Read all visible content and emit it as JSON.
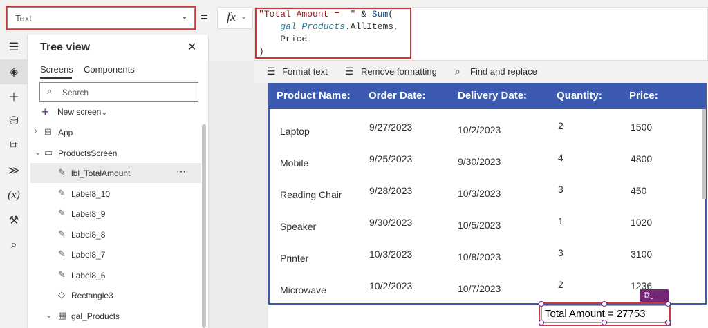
{
  "formula_bar": {
    "property": "Text",
    "equals": "=",
    "fx_label": "fx",
    "formula_lines": [
      {
        "parts": [
          {
            "t": "\"Total Amount =  \"",
            "k": "str"
          },
          {
            "t": " & ",
            "k": "pln"
          },
          {
            "t": "Sum",
            "k": "fn"
          },
          {
            "t": "(",
            "k": "pln"
          }
        ]
      },
      {
        "parts": [
          {
            "t": "    ",
            "k": "pln"
          },
          {
            "t": "gal_Products",
            "k": "ctl"
          },
          {
            "t": ".AllItems,",
            "k": "pln"
          }
        ]
      },
      {
        "parts": [
          {
            "t": "    Price",
            "k": "pln"
          }
        ]
      },
      {
        "parts": [
          {
            "t": ")",
            "k": "pln"
          }
        ]
      }
    ]
  },
  "toolbar": {
    "format_text": "Format text",
    "remove_formatting": "Remove formatting",
    "find_replace": "Find and replace"
  },
  "tree": {
    "title": "Tree view",
    "tabs": {
      "screens": "Screens",
      "components": "Components"
    },
    "search_placeholder": "Search",
    "new_screen": "New screen",
    "items": [
      {
        "label": "App",
        "icon": "app-icon",
        "glyph": "⊞",
        "chevron": "›",
        "indent": 0
      },
      {
        "label": "ProductsScreen",
        "icon": "screen-icon",
        "glyph": "▭",
        "chevron": "⌄",
        "indent": 0
      },
      {
        "label": "lbl_TotalAmount",
        "icon": "label-icon",
        "glyph": "✎",
        "chevron": "",
        "indent": 1,
        "selected": true
      },
      {
        "label": "Label8_10",
        "icon": "label-icon",
        "glyph": "✎",
        "chevron": "",
        "indent": 1
      },
      {
        "label": "Label8_9",
        "icon": "label-icon",
        "glyph": "✎",
        "chevron": "",
        "indent": 1
      },
      {
        "label": "Label8_8",
        "icon": "label-icon",
        "glyph": "✎",
        "chevron": "",
        "indent": 1
      },
      {
        "label": "Label8_7",
        "icon": "label-icon",
        "glyph": "✎",
        "chevron": "",
        "indent": 1
      },
      {
        "label": "Label8_6",
        "icon": "label-icon",
        "glyph": "✎",
        "chevron": "",
        "indent": 1
      },
      {
        "label": "Rectangle3",
        "icon": "rectangle-icon",
        "glyph": "◇",
        "chevron": "",
        "indent": 1
      },
      {
        "label": "gal_Products",
        "icon": "gallery-icon",
        "glyph": "▦",
        "chevron": "⌄",
        "indent": 1
      }
    ]
  },
  "gallery": {
    "headers": [
      "Product Name:",
      "Order Date:",
      "Delivery Date:",
      "Quantity:",
      "Price:"
    ],
    "rows": [
      {
        "name": "Laptop",
        "order": "9/27/2023",
        "delivery": "10/2/2023",
        "qty": "2",
        "price": "1500"
      },
      {
        "name": "Mobile",
        "order": "9/25/2023",
        "delivery": "9/30/2023",
        "qty": "4",
        "price": "4800"
      },
      {
        "name": "Reading Chair",
        "order": "9/28/2023",
        "delivery": "10/3/2023",
        "qty": "3",
        "price": "450"
      },
      {
        "name": "Speaker",
        "order": "9/30/2023",
        "delivery": "10/5/2023",
        "qty": "1",
        "price": "1020"
      },
      {
        "name": "Printer",
        "order": "10/3/2023",
        "delivery": "10/8/2023",
        "qty": "3",
        "price": "3100"
      },
      {
        "name": "Microwave",
        "order": "10/2/2023",
        "delivery": "10/7/2023",
        "qty": "2",
        "price": "1236"
      }
    ]
  },
  "total_label": {
    "text": "Total Amount =  27753"
  },
  "colors": {
    "header": "#3c5ab0",
    "highlight": "#d13438",
    "accent": "#742774"
  }
}
